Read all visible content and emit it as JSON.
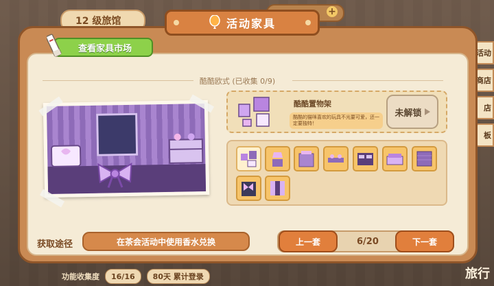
{
  "background": {
    "level_label": "12 级旅馆",
    "side_buttons": [
      "活动",
      "商店",
      "店",
      "板"
    ],
    "collection_label": "功能收集度",
    "collection_value": "16/16",
    "login_label": "80天 累计登录",
    "travel_label": "旅行"
  },
  "header": {
    "title": "活动家具",
    "icon": "balloon-icon"
  },
  "market_button": {
    "label": "查看家具市场",
    "icon": "pen-icon"
  },
  "set": {
    "title": "酷酷欧式 (已收集 0/9)"
  },
  "detail": {
    "name": "酷酷置物架",
    "description": "酷酷的猫咪喜欢的玩具不光要可爱，还一定要独特！",
    "unlock_label": "未解锁"
  },
  "items": [
    {
      "name": "shelf-item",
      "selected": true
    },
    {
      "name": "lamp-item"
    },
    {
      "name": "cabinet-item"
    },
    {
      "name": "bench-item"
    },
    {
      "name": "dresser-item"
    },
    {
      "name": "sofa-item"
    },
    {
      "name": "rug-item"
    },
    {
      "name": "bow-item"
    },
    {
      "name": "curtain-item"
    }
  ],
  "footer": {
    "source_label": "获取途径",
    "source_text": "在茶会活动中使用香水兑换",
    "prev_label": "上一套",
    "page": "6/20",
    "next_label": "下一套"
  },
  "colors": {
    "accent": "#d98242",
    "green": "#8dd14a",
    "panel": "#c98a54"
  }
}
